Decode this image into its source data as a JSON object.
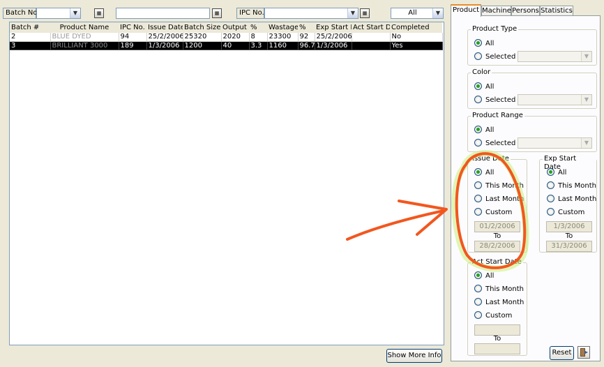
{
  "toolbar": {
    "batch_label": "Batch No.",
    "ipc_label": "IPC No.",
    "filter_value": "All",
    "calendar_icon": "calendar-icon"
  },
  "grid": {
    "columns": [
      "Batch #",
      "Product Name",
      "IPC No.",
      "Issue Date",
      "Batch Size",
      "Output",
      "%",
      "Wastage",
      "%",
      "Exp Start Dt",
      "Act Start Dt",
      "Completed"
    ],
    "rows": [
      [
        "2",
        "BLUE DYED",
        "94",
        "25/2/2006",
        "25320",
        "2020",
        "8",
        "23300",
        "92",
        "25/2/2006",
        "",
        "No"
      ],
      [
        "3",
        "BRILLIANT 3000",
        "189",
        "1/3/2006",
        "1200",
        "40",
        "3.3",
        "1160",
        "96.7",
        "1/3/2006",
        "",
        "Yes"
      ]
    ]
  },
  "buttons": {
    "show_more": "Show More Info",
    "reset": "Reset"
  },
  "tabs": [
    "Product",
    "Machine",
    "Persons",
    "Statistics"
  ],
  "filters": {
    "product_type": {
      "title": "Product Type",
      "opt_all": "All",
      "opt_selected": "Selected"
    },
    "color": {
      "title": "Color",
      "opt_all": "All",
      "opt_selected": "Selected"
    },
    "product_range": {
      "title": "Product Range",
      "opt_all": "All",
      "opt_selected": "Selected"
    },
    "issue_date": {
      "title": "Issue Date",
      "opt_all": "All",
      "opt_this_month": "This Month",
      "opt_last_month": "Last Month",
      "opt_custom": "Custom",
      "from": "01/2/2006",
      "to_label": "To",
      "to": "28/2/2006"
    },
    "exp_start_date": {
      "title": "Exp Start Date",
      "opt_all": "All",
      "opt_this_month": "This Month",
      "opt_last_month": "Last Month",
      "opt_custom": "Custom",
      "from": "1/3/2006",
      "to_label": "To",
      "to": "31/3/2006"
    },
    "act_start_date": {
      "title": "Act Start Date",
      "opt_all": "All",
      "opt_this_month": "This Month",
      "opt_last_month": "Last Month",
      "opt_custom": "Custom",
      "from": "",
      "to_label": "To",
      "to": ""
    }
  },
  "colors": {
    "annotation": "#f2571f",
    "highlight": "#c8ee7a",
    "selection": "#000000",
    "tab_accent": "#e68b2c"
  }
}
